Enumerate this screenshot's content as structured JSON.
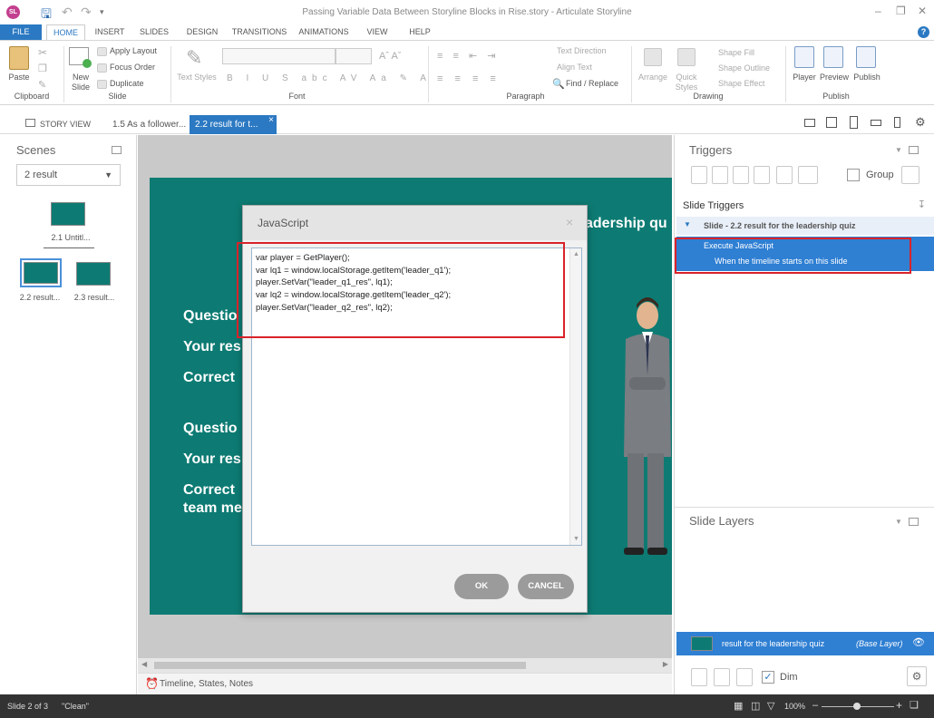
{
  "app": {
    "logo_text": "SL",
    "title": "Passing Variable Data Between Storyline Blocks in Rise.story - Articulate Storyline",
    "help": "?"
  },
  "menu": [
    "FILE",
    "HOME",
    "INSERT",
    "SLIDES",
    "DESIGN",
    "TRANSITIONS",
    "ANIMATIONS",
    "VIEW",
    "HELP"
  ],
  "ribbon": {
    "paste": "Paste",
    "new_slide": "New Slide",
    "apply_layout": "Apply Layout",
    "focus_order": "Focus Order",
    "duplicate": "Duplicate",
    "text_styles": "Text Styles",
    "text_direction": "Text Direction",
    "align_text": "Align Text",
    "find_replace": "Find / Replace",
    "arrange": "Arrange",
    "quick_styles": "Quick Styles",
    "shape_fill": "Shape Fill",
    "shape_outline": "Shape Outline",
    "shape_effect": "Shape Effect",
    "player": "Player",
    "preview": "Preview",
    "publish": "Publish",
    "groups": {
      "clipboard": "Clipboard",
      "slide": "Slide",
      "font": "Font",
      "paragraph": "Paragraph",
      "drawing": "Drawing",
      "publish": "Publish"
    }
  },
  "tabs": {
    "story_view": "STORY VIEW",
    "tab1": "1.5 As a follower...",
    "tab2": "2.2 result for t..."
  },
  "scenes": {
    "title": "Scenes",
    "dropdown": "2 result",
    "slide_a": "2.1 Untitl...",
    "slide_b": "2.2 result...",
    "slide_c": "2.3 result..."
  },
  "slide": {
    "heading": "adership qu",
    "q1": "Questio",
    "r1": "Your res",
    "c1": "Correct",
    "q2": "Questio",
    "r2": "Your res",
    "c2a": "Correct",
    "c2b": "team me"
  },
  "dialog": {
    "title": "JavaScript",
    "close": "×",
    "code": [
      "var player = GetPlayer();",
      "var lq1 = window.localStorage.getItem('leader_q1');",
      "player.SetVar(\"leader_q1_res\", lq1);",
      "var lq2 = window.localStorage.getItem('leader_q2');",
      "player.SetVar(\"leader_q2_res\", lq2);"
    ],
    "ok": "OK",
    "cancel": "CANCEL"
  },
  "triggers": {
    "title": "Triggers",
    "group_label": "Group",
    "section": "Slide Triggers",
    "slide_row": "Slide - 2.2 result for the leadership quiz",
    "action": "Execute JavaScript",
    "condition": "When the timeline starts on this slide"
  },
  "layers": {
    "title": "Slide Layers",
    "base_name": "result for the leadership quiz",
    "base_tag": "(Base Layer)",
    "dim": "Dim"
  },
  "timeline_label": "Timeline, States, Notes",
  "status": {
    "slide": "Slide 2 of 3",
    "state": "\"Clean\"",
    "zoom": "100%"
  },
  "colors": {
    "accent": "#2b79c2",
    "slide_bg": "#0d7b73",
    "highlight": "#d9232a",
    "selection": "#2f7fd3"
  }
}
